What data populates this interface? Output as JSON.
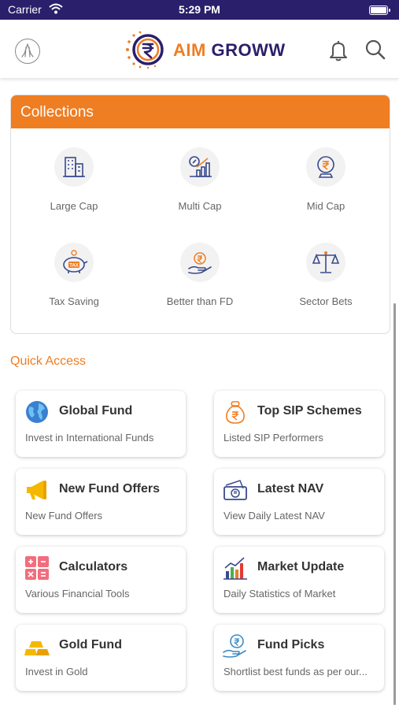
{
  "status_bar": {
    "carrier": "Carrier",
    "time": "5:29 PM"
  },
  "header": {
    "logo_aim": "AIM",
    "logo_groww": "GROWW"
  },
  "collections": {
    "title": "Collections",
    "items": [
      {
        "label": "Large Cap",
        "icon": "building-icon"
      },
      {
        "label": "Multi Cap",
        "icon": "growth-chart-icon"
      },
      {
        "label": "Mid Cap",
        "icon": "rupee-globe-icon"
      },
      {
        "label": "Tax Saving",
        "icon": "tax-piggy-bank-icon"
      },
      {
        "label": "Better than FD",
        "icon": "rupee-hand-icon"
      },
      {
        "label": "Sector Bets",
        "icon": "balance-scale-icon"
      }
    ]
  },
  "quick_access": {
    "title": "Quick Access",
    "tiles": [
      {
        "title": "Global Fund",
        "subtitle": "Invest in International Funds",
        "icon": "globe-icon"
      },
      {
        "title": "Top SIP Schemes",
        "subtitle": "Listed SIP Performers",
        "icon": "money-bag-icon"
      },
      {
        "title": "New Fund Offers",
        "subtitle": "New Fund Offers",
        "icon": "megaphone-icon"
      },
      {
        "title": "Latest NAV",
        "subtitle": "View Daily Latest NAV",
        "icon": "currency-note-icon"
      },
      {
        "title": "Calculators",
        "subtitle": "Various Financial Tools",
        "icon": "calculator-icon"
      },
      {
        "title": "Market Update",
        "subtitle": "Daily Statistics of Market",
        "icon": "market-chart-icon"
      },
      {
        "title": "Gold Fund",
        "subtitle": "Invest in Gold",
        "icon": "gold-bars-icon"
      },
      {
        "title": "Fund Picks",
        "subtitle": "Shortlist best funds as per our...",
        "icon": "rupee-hand-icon"
      }
    ]
  },
  "colors": {
    "accent": "#ef7d22",
    "brand": "#2a1f6b",
    "icon_blue": "#3a4a8c"
  }
}
